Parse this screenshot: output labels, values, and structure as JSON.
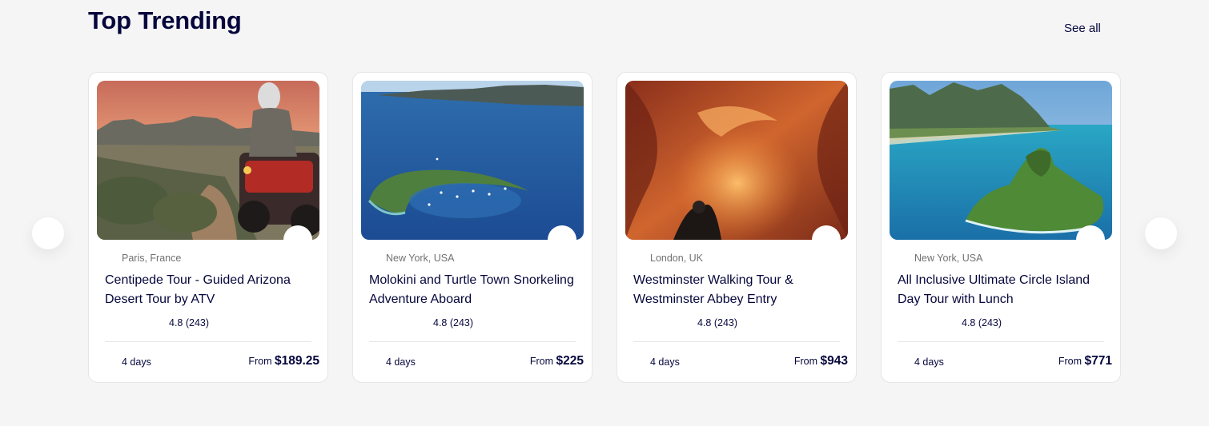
{
  "section": {
    "title": "Top Trending",
    "see_all_label": "See all"
  },
  "cards": [
    {
      "image": "atv-desert-rider",
      "location": "Paris, France",
      "title": "Centipede Tour - Guided Arizona Desert Tour by ATV",
      "rating": "4.8 (243)",
      "duration": "4 days",
      "price_prefix": "From",
      "price": "$189.25"
    },
    {
      "image": "molokini-crater-island",
      "location": "New York, USA",
      "title": "Molokini and Turtle Town Snorkeling Adventure Aboard",
      "rating": "4.8 (243)",
      "duration": "4 days",
      "price_prefix": "From",
      "price": "$225"
    },
    {
      "image": "antelope-canyon",
      "location": "London, UK",
      "title": "Westminster Walking Tour & Westminster Abbey Entry",
      "rating": "4.8 (243)",
      "duration": "4 days",
      "price_prefix": "From",
      "price": "$943"
    },
    {
      "image": "chinamans-hat-island",
      "location": "New York, USA",
      "title": "All Inclusive Ultimate Circle Island Day Tour with Lunch",
      "rating": "4.8 (243)",
      "duration": "4 days",
      "price_prefix": "From",
      "price": "$771"
    }
  ],
  "colors": {
    "heading": "#05073c",
    "muted": "#717171",
    "background": "#f5f5f5",
    "card_border": "#e7e6e6"
  }
}
